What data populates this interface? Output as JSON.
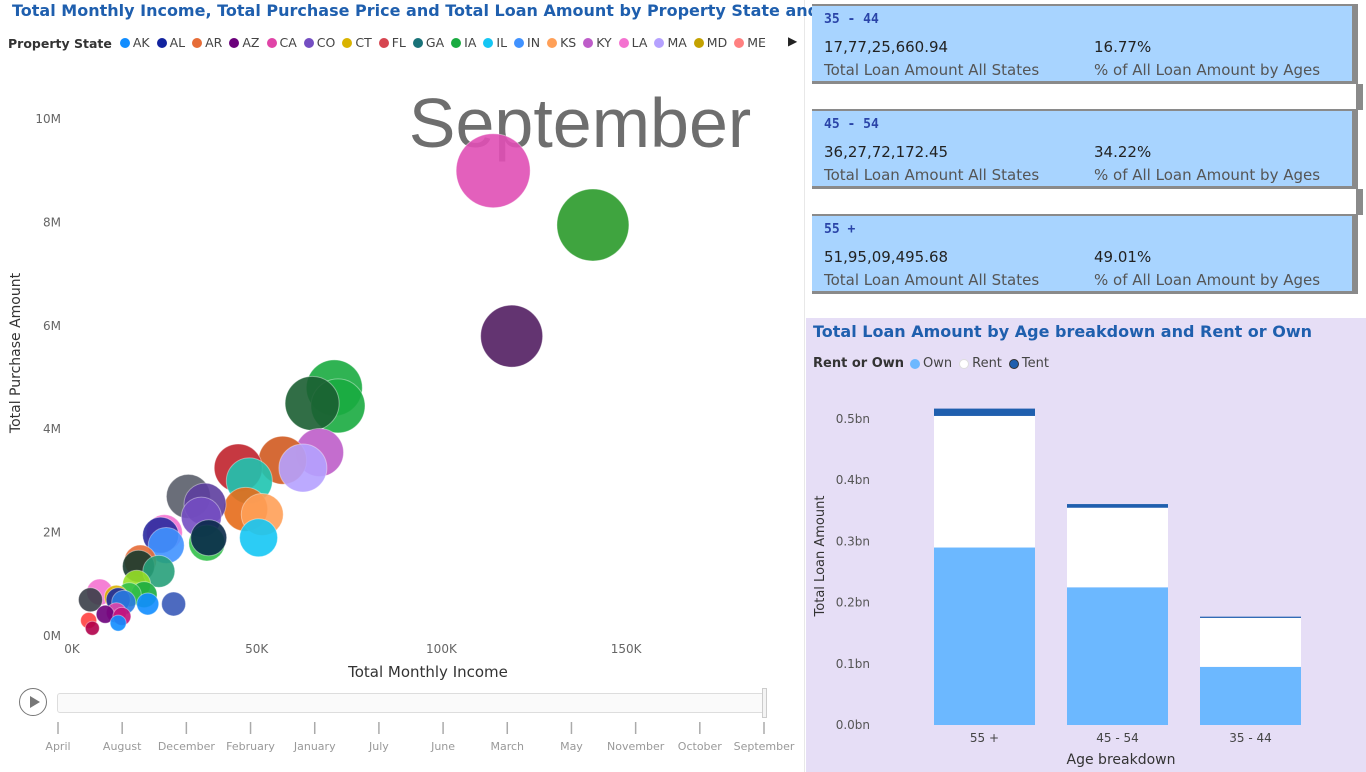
{
  "scatter": {
    "title": "Total Monthly Income, Total Purchase Price and Total Loan Amount by Property State and Month",
    "legend_label": "Property State",
    "legend_items": [
      {
        "name": "AK",
        "color": "#118dff"
      },
      {
        "name": "AL",
        "color": "#12239e"
      },
      {
        "name": "AR",
        "color": "#e66c37"
      },
      {
        "name": "AZ",
        "color": "#6b007b"
      },
      {
        "name": "CA",
        "color": "#e044a7"
      },
      {
        "name": "CO",
        "color": "#744ec2"
      },
      {
        "name": "CT",
        "color": "#d9b300"
      },
      {
        "name": "FL",
        "color": "#d64550"
      },
      {
        "name": "GA",
        "color": "#197278"
      },
      {
        "name": "IA",
        "color": "#1aab40"
      },
      {
        "name": "IL",
        "color": "#15c6f4"
      },
      {
        "name": "IN",
        "color": "#4092ff"
      },
      {
        "name": "KS",
        "color": "#ffa058"
      },
      {
        "name": "KY",
        "color": "#be5dc9"
      },
      {
        "name": "LA",
        "color": "#f472d0"
      },
      {
        "name": "MA",
        "color": "#b5a1ff"
      },
      {
        "name": "MD",
        "color": "#c4a200"
      },
      {
        "name": "ME",
        "color": "#ff8080"
      }
    ],
    "play_axis_labels": [
      "April",
      "August",
      "December",
      "February",
      "January",
      "July",
      "June",
      "March",
      "May",
      "November",
      "October",
      "September"
    ],
    "current_frame": "September"
  },
  "chart_data": [
    {
      "type": "scatter",
      "title": "Total Monthly Income, Total Purchase Price and Total Loan Amount by Property State and Month",
      "xlabel": "Total Monthly Income",
      "ylabel": "Total Purchase Amount",
      "xlim": [
        0,
        180000
      ],
      "ylim": [
        0,
        10000000
      ],
      "x_ticks": [
        "0K",
        "50K",
        "100K",
        "150K"
      ],
      "y_ticks": [
        "0M",
        "2M",
        "4M",
        "6M",
        "8M",
        "10M"
      ],
      "size_measure": "Total Loan Amount",
      "frame_label": "September",
      "points": [
        {
          "x": 114000,
          "y": 9000000,
          "r": 37,
          "color": "#e04fb5"
        },
        {
          "x": 141000,
          "y": 7950000,
          "r": 36,
          "color": "#2a9a2a"
        },
        {
          "x": 119000,
          "y": 5800000,
          "r": 31,
          "color": "#521e62"
        },
        {
          "x": 71000,
          "y": 4800000,
          "r": 28,
          "color": "#1aab40"
        },
        {
          "x": 72000,
          "y": 4450000,
          "r": 27,
          "color": "#1aab40"
        },
        {
          "x": 65000,
          "y": 4500000,
          "r": 27,
          "color": "#1b5e32"
        },
        {
          "x": 67000,
          "y": 3550000,
          "r": 24,
          "color": "#be5dc9"
        },
        {
          "x": 57000,
          "y": 3400000,
          "r": 24,
          "color": "#d05a20"
        },
        {
          "x": 45000,
          "y": 3250000,
          "r": 24,
          "color": "#c0222c"
        },
        {
          "x": 62500,
          "y": 3250000,
          "r": 24,
          "color": "#b5a1ff"
        },
        {
          "x": 48000,
          "y": 3000000,
          "r": 23,
          "color": "#1ec4b0"
        },
        {
          "x": 31500,
          "y": 2700000,
          "r": 22,
          "color": "#5a5e6a"
        },
        {
          "x": 36000,
          "y": 2550000,
          "r": 21,
          "color": "#5d3e9e"
        },
        {
          "x": 35000,
          "y": 2300000,
          "r": 20,
          "color": "#744ec2"
        },
        {
          "x": 47000,
          "y": 2450000,
          "r": 22,
          "color": "#e66c1a"
        },
        {
          "x": 51500,
          "y": 2350000,
          "r": 21,
          "color": "#ffa058"
        },
        {
          "x": 25000,
          "y": 2000000,
          "r": 18,
          "color": "#f472d0"
        },
        {
          "x": 24000,
          "y": 1950000,
          "r": 18,
          "color": "#2a2a9e"
        },
        {
          "x": 25500,
          "y": 1750000,
          "r": 18,
          "color": "#4092ff"
        },
        {
          "x": 36500,
          "y": 1800000,
          "r": 18,
          "color": "#32c04a"
        },
        {
          "x": 37000,
          "y": 1900000,
          "r": 18,
          "color": "#0a2a4a"
        },
        {
          "x": 50500,
          "y": 1900000,
          "r": 19,
          "color": "#15c6f4"
        },
        {
          "x": 18500,
          "y": 1450000,
          "r": 16,
          "color": "#e66c37"
        },
        {
          "x": 18000,
          "y": 1350000,
          "r": 16,
          "color": "#183a2e"
        },
        {
          "x": 23500,
          "y": 1250000,
          "r": 16,
          "color": "#27a07a"
        },
        {
          "x": 17500,
          "y": 1000000,
          "r": 14,
          "color": "#96e028"
        },
        {
          "x": 19500,
          "y": 800000,
          "r": 13,
          "color": "#1aab40"
        },
        {
          "x": 15500,
          "y": 800000,
          "r": 12,
          "color": "#34c04a"
        },
        {
          "x": 7500,
          "y": 850000,
          "r": 13,
          "color": "#f472d0"
        },
        {
          "x": 12000,
          "y": 750000,
          "r": 12,
          "color": "#d9b300"
        },
        {
          "x": 5000,
          "y": 700000,
          "r": 12,
          "color": "#3a3e48"
        },
        {
          "x": 12500,
          "y": 700000,
          "r": 12,
          "color": "#1a2a9e"
        },
        {
          "x": 14000,
          "y": 650000,
          "r": 12,
          "color": "#2a7ae0"
        },
        {
          "x": 27500,
          "y": 620000,
          "r": 12,
          "color": "#3a5ab8"
        },
        {
          "x": 20500,
          "y": 620000,
          "r": 11,
          "color": "#118dff"
        },
        {
          "x": 12000,
          "y": 450000,
          "r": 10,
          "color": "#e044a7"
        },
        {
          "x": 9000,
          "y": 420000,
          "r": 9,
          "color": "#6b007b"
        },
        {
          "x": 13500,
          "y": 380000,
          "r": 9,
          "color": "#c0107b"
        },
        {
          "x": 4500,
          "y": 300000,
          "r": 8,
          "color": "#ff4040"
        },
        {
          "x": 12500,
          "y": 250000,
          "r": 8,
          "color": "#118dff"
        },
        {
          "x": 5500,
          "y": 150000,
          "r": 7,
          "color": "#b0004a"
        }
      ]
    },
    {
      "type": "bar",
      "title": "Total Loan Amount by Age breakdown and Rent or Own",
      "xlabel": "Age breakdown",
      "ylabel": "Total Loan Amount",
      "ylim": [
        0,
        0.5
      ],
      "y_ticks": [
        "0.0bn",
        "0.1bn",
        "0.2bn",
        "0.3bn",
        "0.4bn",
        "0.5bn"
      ],
      "legend_label": "Rent or Own",
      "categories": [
        "55 +",
        "45 - 54",
        "35 - 44"
      ],
      "series": [
        {
          "name": "Own",
          "color": "#6cb8ff",
          "values": [
            0.29,
            0.225,
            0.095
          ]
        },
        {
          "name": "Rent",
          "color": "#ffffff",
          "values": [
            0.215,
            0.13,
            0.08
          ]
        },
        {
          "name": "Tent",
          "color": "#1f5fae",
          "values": [
            0.012,
            0.006,
            0.002
          ]
        }
      ]
    }
  ],
  "kpi_cards": [
    {
      "age": "35 - 44",
      "value": "17,77,25,660.94",
      "pct": "16.77%",
      "label_left": "Total Loan Amount All States",
      "label_right": "% of All Loan Amount by Ages"
    },
    {
      "age": "45 - 54",
      "value": "36,27,72,172.45",
      "pct": "34.22%",
      "label_left": "Total Loan Amount All States",
      "label_right": "% of All Loan Amount by Ages"
    },
    {
      "age": "55 +",
      "value": "51,95,09,495.68",
      "pct": "49.01%",
      "label_left": "Total Loan Amount All States",
      "label_right": "% of All Loan Amount by Ages"
    }
  ]
}
